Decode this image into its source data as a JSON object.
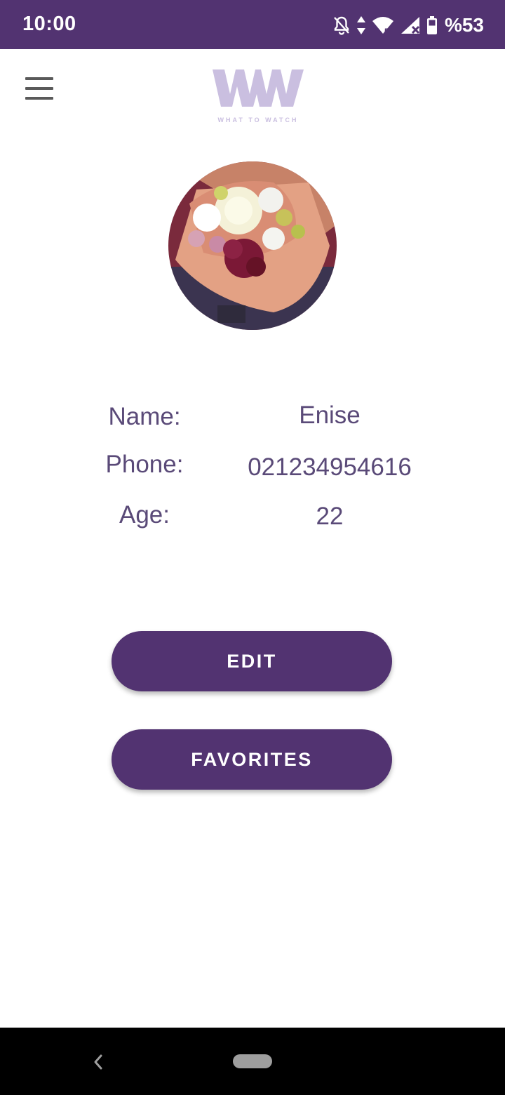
{
  "status_bar": {
    "time": "10:00",
    "battery": "%53",
    "icons": [
      "notifications-off-icon",
      "data-arrows-icon",
      "wifi-icon",
      "signal-no-service-icon",
      "battery-icon"
    ]
  },
  "header": {
    "menu_icon": "hamburger-menu-icon",
    "logo_mark": "WW",
    "logo_tagline": "WHAT TO WATCH"
  },
  "profile": {
    "avatar": "flower-bouquet-photo",
    "fields": [
      {
        "label": "Name:",
        "value": "Enise"
      },
      {
        "label": "Phone:",
        "value": "021234954616"
      },
      {
        "label": "Age:",
        "value": "22"
      }
    ]
  },
  "actions": {
    "edit_label": "EDIT",
    "favorites_label": "FAVORITES"
  },
  "navigation": {
    "back_icon": "back-chevron-icon",
    "home_icon": "home-pill-icon"
  },
  "colors": {
    "primary": "#523371",
    "logo": "#cabfe0",
    "text": "#5a4a78"
  }
}
